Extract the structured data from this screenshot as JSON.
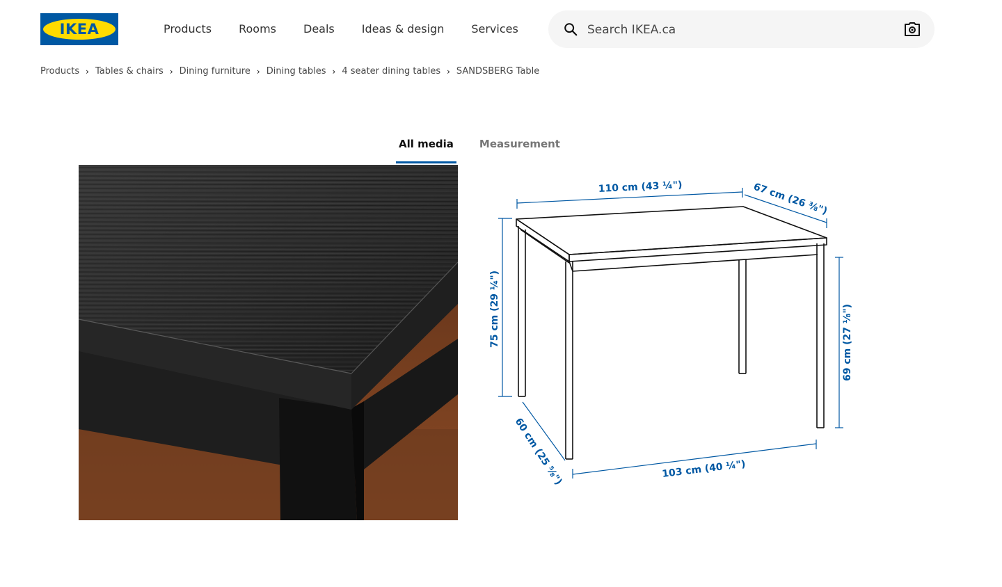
{
  "header": {
    "logo_text": "IKEA",
    "nav": [
      "Products",
      "Rooms",
      "Deals",
      "Ideas & design",
      "Services"
    ],
    "search_placeholder": "Search IKEA.ca"
  },
  "breadcrumb": [
    "Products",
    "Tables & chairs",
    "Dining furniture",
    "Dining tables",
    "4 seater dining tables",
    "SANDSBERG Table"
  ],
  "media_tabs": [
    {
      "label": "All media",
      "active": true
    },
    {
      "label": "Measurement",
      "active": false
    }
  ],
  "measurements": {
    "width": "110 cm (43 ¼\")",
    "depth_top": "67 cm (26 ⅜\")",
    "height": "75 cm (29 ¼\")",
    "leg_height": "69 cm (27 ⅛\")",
    "depth_base": "60 cm (25 ⅝\")",
    "width_base": "103 cm (40 ¼\")"
  },
  "colors": {
    "brand_blue": "#0058a3",
    "brand_yellow": "#ffdb00"
  }
}
